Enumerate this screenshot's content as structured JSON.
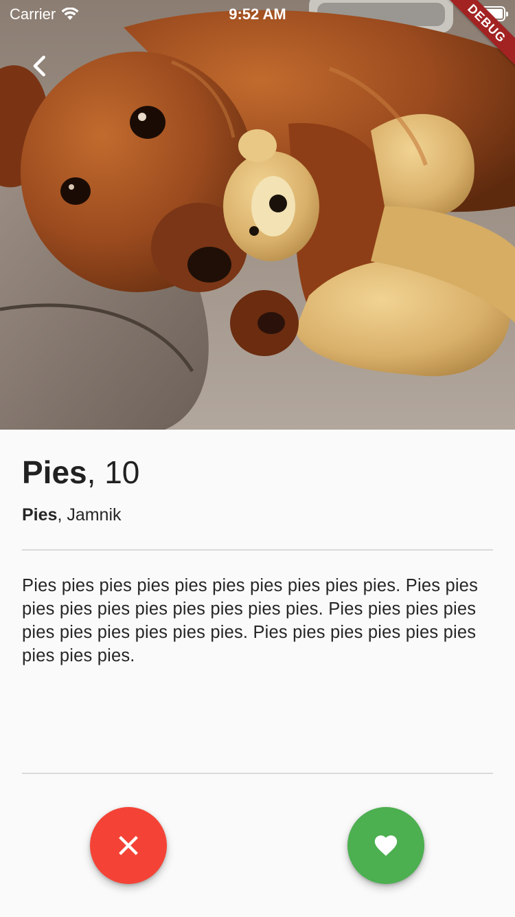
{
  "status_bar": {
    "carrier": "Carrier",
    "time": "9:52 AM",
    "wifi_icon": "wifi-icon",
    "battery_icon": "battery-icon"
  },
  "debug_banner": "DEBUG",
  "header": {
    "back_icon": "chevron-left-icon"
  },
  "hero": {
    "image": "photo of a dachshund cuddling a plush teddy bear"
  },
  "profile": {
    "name": "Pies",
    "age": ", 10",
    "species": "Pies",
    "breed": ", Jamnik",
    "description": "Pies pies pies pies pies pies pies pies pies pies. Pies pies pies pies pies pies pies pies pies pies. Pies pies pies pies pies pies pies pies pies pies. Pies pies pies pies pies pies pies pies pies."
  },
  "actions": {
    "dislike_icon": "close-icon",
    "like_icon": "heart-icon"
  },
  "colors": {
    "dislike": "#f44336",
    "like": "#4caf50",
    "background": "#fafafa",
    "divider": "#dadada",
    "debug_ribbon": "#a32222"
  }
}
